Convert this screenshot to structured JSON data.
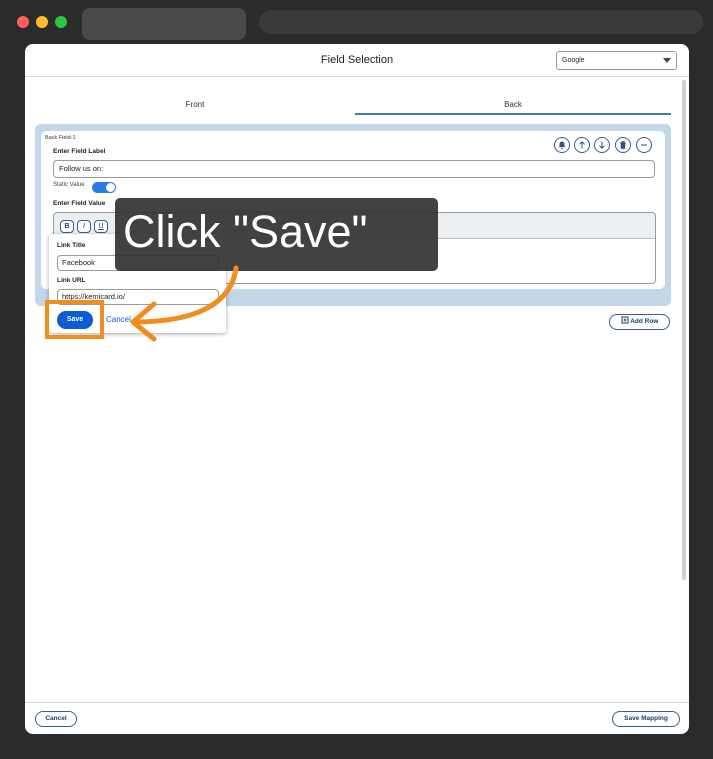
{
  "window": {
    "controls": [
      "close",
      "minimize",
      "maximize"
    ]
  },
  "modal": {
    "title": "Field Selection",
    "provider_select": {
      "value": "Google"
    },
    "tabs": [
      {
        "label": "Front",
        "active": false
      },
      {
        "label": "Back",
        "active": true
      }
    ]
  },
  "field": {
    "title": "Back Field-1",
    "actions": [
      "bell-icon",
      "arrow-up-icon",
      "arrow-down-icon",
      "trash-icon",
      "minus-icon"
    ],
    "label_heading": "Enter Field Label",
    "label_value": "Follow us on:",
    "static_label": "Static Value",
    "static_on": true,
    "value_heading": "Enter Field Value",
    "toolbar": {
      "bold": "B",
      "italic": "I",
      "underline": "U"
    }
  },
  "link_popup": {
    "title_label": "Link Title",
    "title_value": "Facebook",
    "url_label": "Link URL",
    "url_value": "https://kemicard.io/",
    "save_label": "Save",
    "cancel_label": "Cancel"
  },
  "add_row_label": "Add Row",
  "footer": {
    "cancel_label": "Cancel",
    "save_mapping_label": "Save Mapping"
  },
  "callout": {
    "text": "Click \"Save\""
  },
  "colors": {
    "accent": "#0b5cd5",
    "highlight": "#f28c1c",
    "section_bg": "#c3d7ea",
    "toggle_on": "#2a7be4"
  }
}
